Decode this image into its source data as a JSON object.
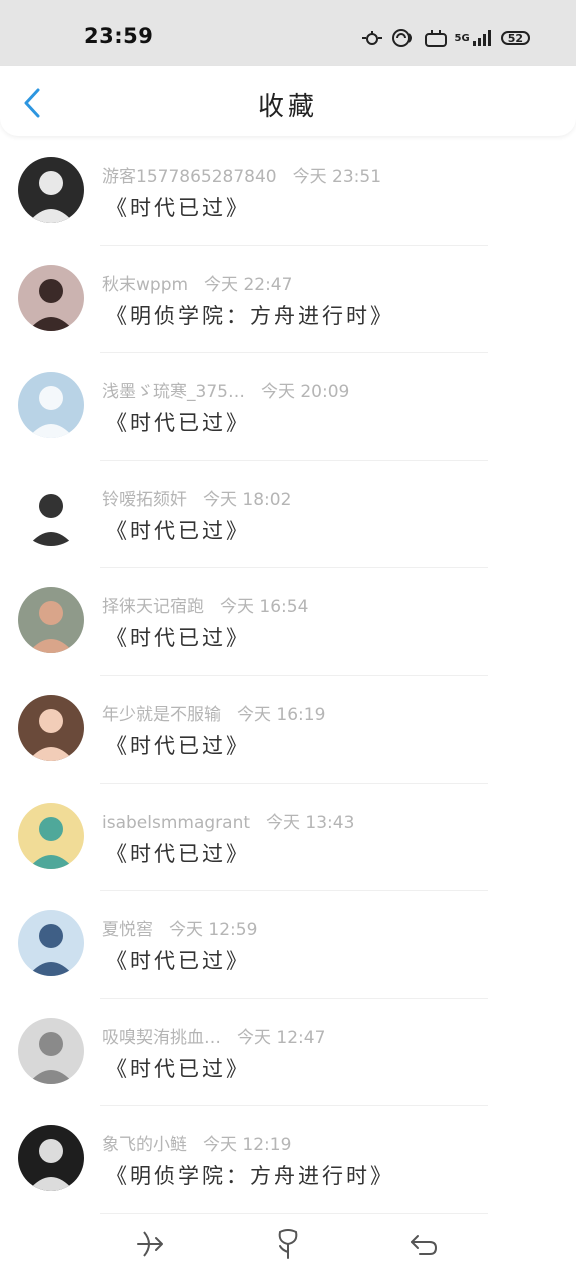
{
  "status_bar": {
    "time": "23:59",
    "battery": "52",
    "network": "5G"
  },
  "header": {
    "title": "收藏"
  },
  "colors": {
    "accent": "#2d96e0",
    "meta_text": "#b5b5b5",
    "status_bg": "#e5e5e5"
  },
  "items": [
    {
      "user": "游客1577865287840",
      "time": "今天 23:51",
      "work": "《时代已过》",
      "avatar": {
        "bg": "#2a2a2a",
        "fg": "#e8e8e8"
      }
    },
    {
      "user": "秋末wppm",
      "time": "今天 22:47",
      "work": "《明侦学院：方舟进行时》",
      "avatar": {
        "bg": "#cbb3b0",
        "fg": "#3b2a28"
      }
    },
    {
      "user": "浅墨ゞ琉寒_375…",
      "time": "今天 20:09",
      "work": "《时代已过》",
      "avatar": {
        "bg": "#b9d3e6",
        "fg": "#f4f8fb"
      }
    },
    {
      "user": "铃嗳拓颏奸",
      "time": "今天 18:02",
      "work": "《时代已过》",
      "avatar": {
        "bg": "#ffffff",
        "fg": "#333333"
      }
    },
    {
      "user": "择徕天记宿跑",
      "time": "今天 16:54",
      "work": "《时代已过》",
      "avatar": {
        "bg": "#8f9a8a",
        "fg": "#d9a58a"
      }
    },
    {
      "user": "年少就是不服输",
      "time": "今天 16:19",
      "work": "《时代已过》",
      "avatar": {
        "bg": "#6a4a3a",
        "fg": "#f2cdb8"
      }
    },
    {
      "user": "isabelsmmagrant",
      "time": "今天 13:43",
      "work": "《时代已过》",
      "avatar": {
        "bg": "#f1dc97",
        "fg": "#4fa89a"
      }
    },
    {
      "user": "夏悦窖",
      "time": "今天 12:59",
      "work": "《时代已过》",
      "avatar": {
        "bg": "#cde0ef",
        "fg": "#3f5f86"
      }
    },
    {
      "user": "吸嗅契洧挑血…",
      "time": "今天 12:47",
      "work": "《时代已过》",
      "avatar": {
        "bg": "#d8d8d8",
        "fg": "#8a8a8a"
      }
    },
    {
      "user": "象飞的小鲢",
      "time": "今天 12:19",
      "work": "《明侦学院：方舟进行时》",
      "avatar": {
        "bg": "#1e1e1e",
        "fg": "#dcdcdc"
      }
    }
  ]
}
